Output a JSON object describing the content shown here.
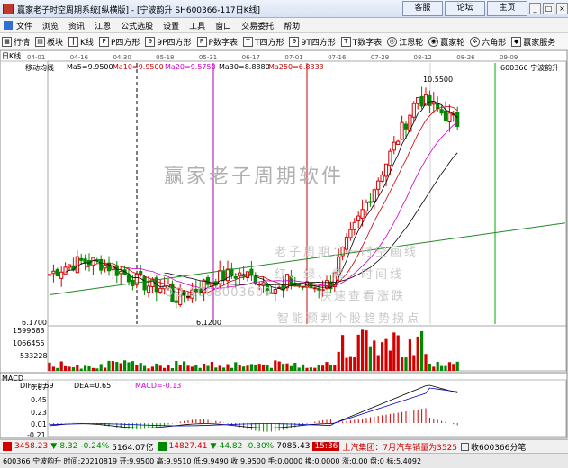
{
  "window": {
    "title": "赢家老子时空周期系统[纵横版] - [宁波韵升  SH600366-117日K线]",
    "buttons": [
      "客服",
      "论坛",
      "主页"
    ]
  },
  "menu": [
    "文件",
    "浏览",
    "资讯",
    "江恩",
    "公式选股",
    "设置",
    "工具",
    "窗口",
    "交易委托",
    "帮助"
  ],
  "toolbar": [
    "行情",
    "板块",
    "K线",
    "P四方形",
    "9P四方形",
    "P数字表",
    "T四方形",
    "9T四方形",
    "T数字表",
    "江恩轮",
    "赢家轮",
    "六角形",
    "赢家服务"
  ],
  "chart": {
    "period_label": "日K线",
    "stock_code_name": "600366 宁波韵升",
    "indicator_name": "移动均线",
    "ma": [
      {
        "label": "Ma5=9.9500",
        "color": "#000000"
      },
      {
        "label": "Ma10=9.9500",
        "color": "#cc0000"
      },
      {
        "label": "Ma20=9.5750",
        "color": "#cc00cc"
      },
      {
        "label": "Ma30=8.8880",
        "color": "#000000"
      },
      {
        "label": "Ma250=6.8333",
        "color": "#cc0000"
      }
    ],
    "date_ticks": [
      "04-01",
      "04-16",
      "04-30",
      "05-18",
      "05-31",
      "06-17",
      "07-01",
      "07-16",
      "07-29",
      "08-12",
      "08-26",
      "09-09"
    ],
    "high_label": "10.5500",
    "low_label": "6.1200",
    "price_low_axis": "6.1700",
    "watermark": "赢家老子周期软件",
    "promo_lines": [
      "老子周期：一时空画线",
      "红、绿、紫：时间线",
      "QQ:1008003609",
      "快速查看涨跌",
      "智能预判个股趋势拐点"
    ],
    "volume_axis": [
      "1599683",
      "1066455",
      "533228"
    ],
    "macd": {
      "name": "MACD",
      "dif": "DIF=0.59",
      "dea": "DEA=0.65",
      "macd": "MACD=-0.13",
      "axis": [
        "0.67",
        "0.45",
        "0.23",
        "0.01",
        "-0.21"
      ]
    }
  },
  "status": {
    "sh_index": "3458.23",
    "sh_change": "▼-8.32",
    "sh_pct": "-0.24%",
    "sh_amount": "5164.07亿",
    "sz_index": "14827.41",
    "sz_change": "▼-44.82",
    "sz_pct": "-0.30%",
    "sz_amount": "7085.43",
    "news_time": "15:36",
    "news_text": "上汽集团：7月汽车销量为3525",
    "extra": "收600366分笔",
    "detail": "600366 宁波韵升  时间:20210819  开:9.9500  高:9.9510  低:9.9490  收:9.9500  手:0.0000  换:0.0000  涨:0.00  盘:0  标:5.4092"
  },
  "colors": {
    "up": "#d40000",
    "down": "#008800",
    "ma5": "#000000",
    "ma10": "#cc0000",
    "ma20": "#cc00cc",
    "ma250": "#228822"
  }
}
